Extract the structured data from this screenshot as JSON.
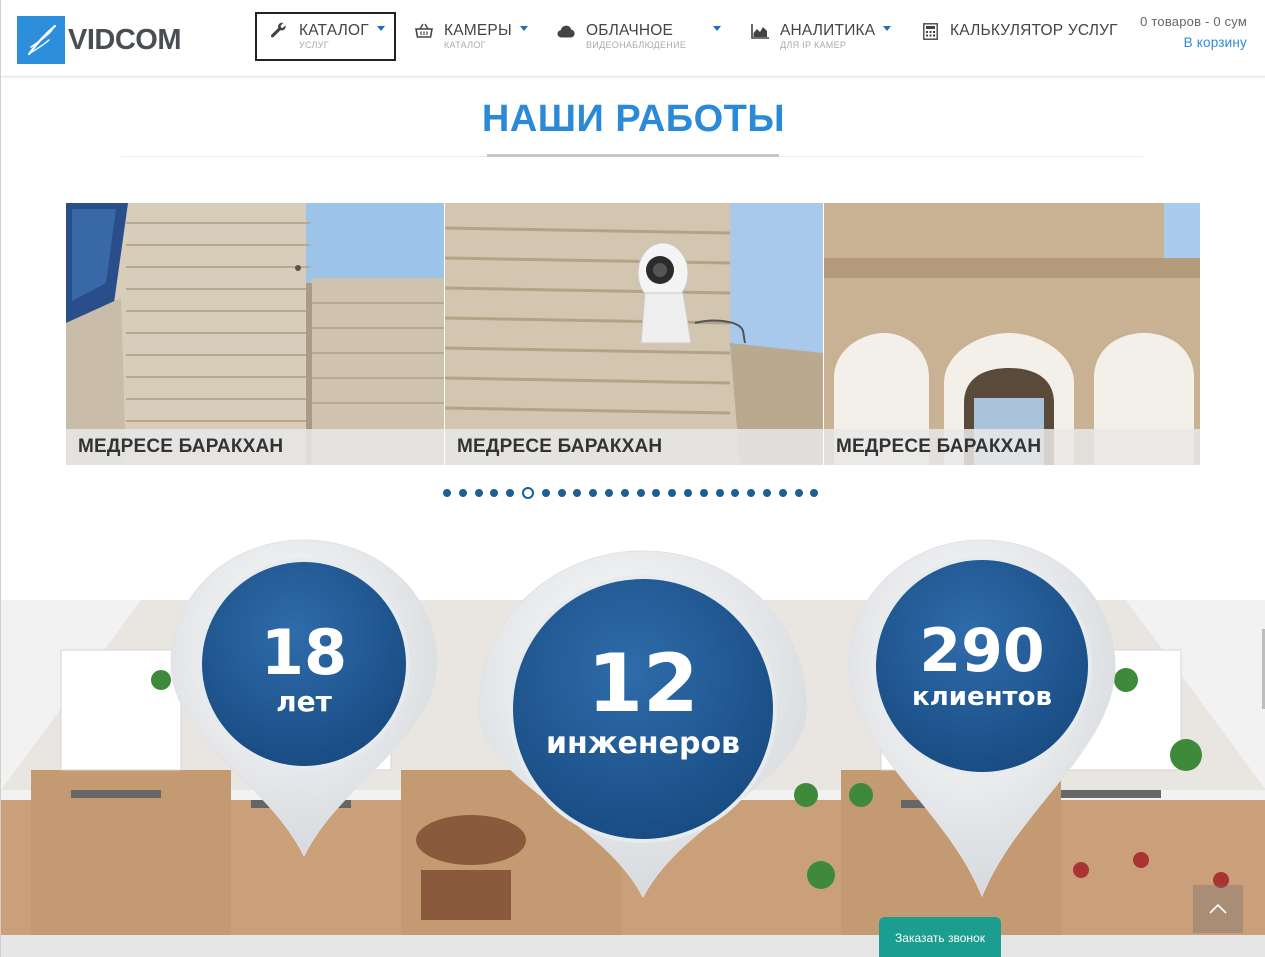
{
  "header": {
    "logo_text": "VIDCOM",
    "nav": [
      {
        "title": "КАТАЛОГ",
        "sub": "УСЛУГ",
        "icon": "wrench-icon",
        "active": true,
        "dropdown": true
      },
      {
        "title": "КАМЕРЫ",
        "sub": "КАТАЛОГ",
        "icon": "basket-icon",
        "active": false,
        "dropdown": true
      },
      {
        "title": "ОБЛАЧНОЕ",
        "sub": "ВИДЕОНАБЛЮДЕНИЕ",
        "icon": "cloud-icon",
        "active": false,
        "dropdown": true
      },
      {
        "title": "АНАЛИТИКА",
        "sub": "ДЛЯ IP КАМЕР",
        "icon": "area-chart-icon",
        "active": false,
        "dropdown": true
      },
      {
        "title": "КАЛЬКУЛЯТОР УСЛУГ",
        "sub": "",
        "icon": "calculator-icon",
        "active": false,
        "dropdown": false
      }
    ],
    "cart": {
      "count_text": "0  товаров - 0 сум",
      "link_text": "В корзину"
    }
  },
  "works": {
    "title": "НАШИ РАБОТЫ",
    "slides": [
      {
        "caption": "МЕДРЕСЕ БАРАКХАН"
      },
      {
        "caption": "МЕДРЕСЕ БАРАКХАН"
      },
      {
        "caption": "МЕДРЕСЕ БАРАКХАН"
      }
    ],
    "dots_total": 24,
    "current_dot": 5
  },
  "stats": [
    {
      "number": "18",
      "label": "лет"
    },
    {
      "number": "12",
      "label": "инженеров"
    },
    {
      "number": "290",
      "label": "клиентов"
    }
  ],
  "callback_label": "Заказать звонок",
  "colors": {
    "accent": "#2b8ad8",
    "logo_bg": "#2d8fdc",
    "stat_circle": "#1e5894",
    "callback": "#1b9d8f"
  }
}
